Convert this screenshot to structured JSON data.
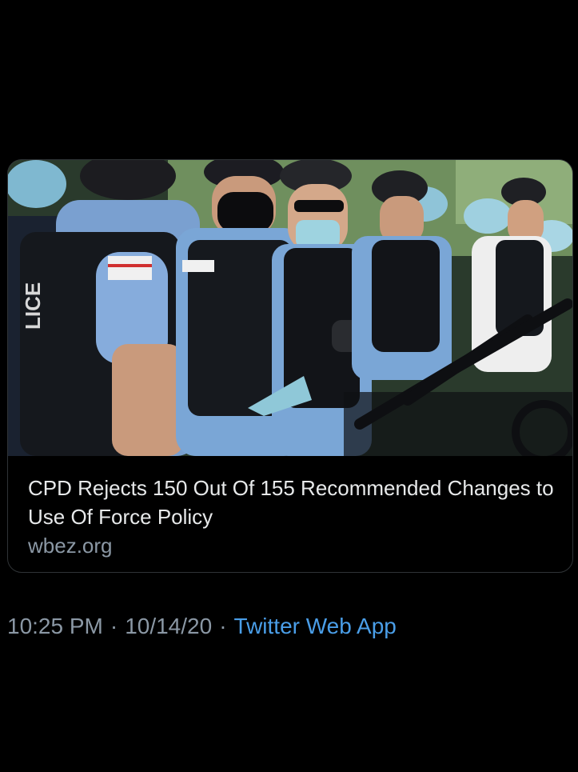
{
  "card": {
    "title": "CPD Rejects 150 Out Of 155 Recommended Changes to Use Of Force Policy",
    "domain": "wbez.org",
    "image_alt": "",
    "image_text": "LICE"
  },
  "meta": {
    "time": "10:25 PM",
    "separator": "·",
    "date": "10/14/20",
    "source": "Twitter Web App"
  },
  "colors": {
    "background": "#000000",
    "text_primary": "#e7e9ea",
    "text_secondary": "#8b98a5",
    "link": "#4a9ee8",
    "card_border": "#2f3336"
  }
}
